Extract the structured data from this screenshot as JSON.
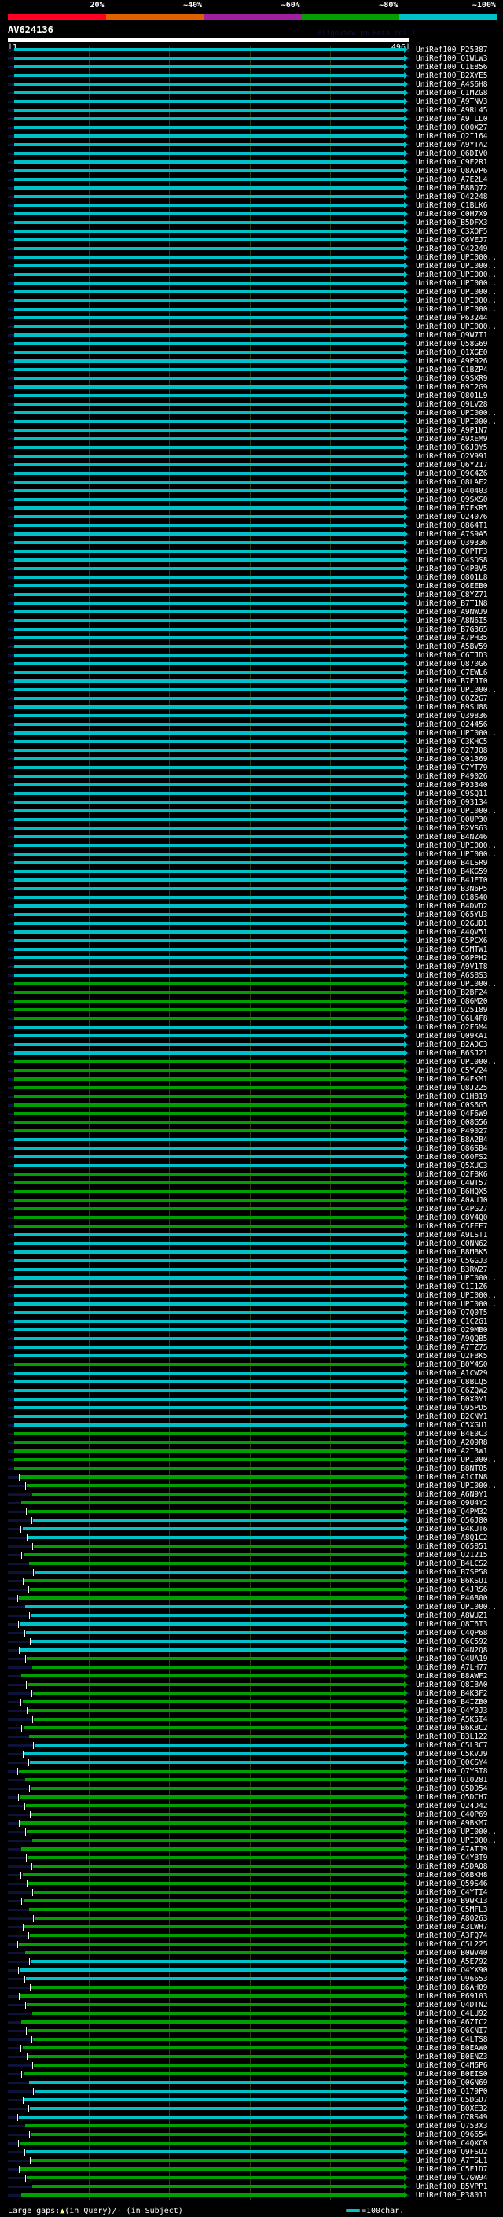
{
  "header": {
    "identity_scale": [
      {
        "label": "20%",
        "color": "#ff0022"
      },
      {
        "label": "~40%",
        "color": "#e06000"
      },
      {
        "label": "~60%",
        "color": "#a020a0"
      },
      {
        "label": "~80%",
        "color": "#00a000"
      },
      {
        "label": "~100%",
        "color": "#00c0c8"
      }
    ],
    "query_name": "AV624136",
    "version": "AlignView.pm Beta rel.7",
    "query_start": "|1",
    "query_end": "496|",
    "query_length": 496
  },
  "hits": [
    "UniRef100_P25387",
    "UniRef100_Q1WLW3",
    "UniRef100_C1E856",
    "UniRef100_B2XYE5",
    "UniRef100_A4S6H8",
    "UniRef100_C1MZG8",
    "UniRef100_A9TNV3",
    "UniRef100_A9RL45",
    "UniRef100_A9TLL0",
    "UniRef100_Q00X27",
    "UniRef100_Q2I164",
    "UniRef100_A9YTA2",
    "UniRef100_Q6DIV0",
    "UniRef100_C9E2R1",
    "UniRef100_Q8AVP6",
    "UniRef100_A7E2L4",
    "UniRef100_B8BQ72",
    "UniRef100_O42248",
    "UniRef100_C1BLK6",
    "UniRef100_C0H7X9",
    "UniRef100_B5DFX3",
    "UniRef100_C3XQF5",
    "UniRef100_Q6VEJ7",
    "UniRef100_O42249",
    "UniRef100_UPI000..",
    "UniRef100_UPI000..",
    "UniRef100_UPI000..",
    "UniRef100_UPI000..",
    "UniRef100_UPI000..",
    "UniRef100_UPI000..",
    "UniRef100_UPI000..",
    "UniRef100_P63244",
    "UniRef100_UPI000..",
    "UniRef100_Q9W7I1",
    "UniRef100_Q58G69",
    "UniRef100_Q1XGE0",
    "UniRef100_A9P926",
    "UniRef100_C1BZP4",
    "UniRef100_Q9SXR9",
    "UniRef100_B9I2G9",
    "UniRef100_Q801L9",
    "UniRef100_Q9LV28",
    "UniRef100_UPI000..",
    "UniRef100_UPI000..",
    "UniRef100_A9P1N7",
    "UniRef100_A9XEM9",
    "UniRef100_Q6J0Y5",
    "UniRef100_Q2V991",
    "UniRef100_Q6Y217",
    "UniRef100_Q9C4Z6",
    "UniRef100_Q8LAF2",
    "UniRef100_Q40403",
    "UniRef100_Q9SXS0",
    "UniRef100_B7FKR5",
    "UniRef100_O24076",
    "UniRef100_Q864T1",
    "UniRef100_A7S9A5",
    "UniRef100_Q39336",
    "UniRef100_C0PTF3",
    "UniRef100_Q4SDS8",
    "UniRef100_Q4PBV5",
    "UniRef100_Q801L8",
    "UniRef100_Q6EEB0",
    "UniRef100_C8YZ71",
    "UniRef100_B7T1N8",
    "UniRef100_A9NWJ9",
    "UniRef100_A8N6I5",
    "UniRef100_B7G365",
    "UniRef100_A7PH35",
    "UniRef100_A5BV59",
    "UniRef100_C6TJD3",
    "UniRef100_Q870G6",
    "UniRef100_C7EWL6",
    "UniRef100_B7FJT0",
    "UniRef100_UPI000..",
    "UniRef100_C0Z2G7",
    "UniRef100_B9SU88",
    "UniRef100_Q39836",
    "UniRef100_O24456",
    "UniRef100_UPI000..",
    "UniRef100_C3KHC5",
    "UniRef100_Q27JQ8",
    "UniRef100_Q01369",
    "UniRef100_C7YT79",
    "UniRef100_P49026",
    "UniRef100_P93340",
    "UniRef100_C9SQ11",
    "UniRef100_Q93134",
    "UniRef100_UPI000..",
    "UniRef100_Q0UP30",
    "UniRef100_B2VS63",
    "UniRef100_B4NZ46",
    "UniRef100_UPI000..",
    "UniRef100_UPI000..",
    "UniRef100_B4LSR9",
    "UniRef100_B4KG59",
    "UniRef100_B4JEI0",
    "UniRef100_B3N6P5",
    "UniRef100_O18640",
    "UniRef100_B4DVD2",
    "UniRef100_Q65YU3",
    "UniRef100_Q2GUD1",
    "UniRef100_A4QV51",
    "UniRef100_C5PCX6",
    "UniRef100_C5MTW1",
    "UniRef100_Q6PPH2",
    "UniRef100_A9V1T8",
    "UniRef100_A6SBS3",
    "UniRef100_UPI000..",
    "UniRef100_B2BF24",
    "UniRef100_Q86M20",
    "UniRef100_Q25189",
    "UniRef100_Q6L4F8",
    "UniRef100_Q2F5M4",
    "UniRef100_Q09KA1",
    "UniRef100_B2ADC3",
    "UniRef100_B6SJ21",
    "UniRef100_UPI000..",
    "UniRef100_C5YV24",
    "UniRef100_B4FKM1",
    "UniRef100_Q8J225",
    "UniRef100_C1H819",
    "UniRef100_C0S6G5",
    "UniRef100_Q4F6W9",
    "UniRef100_Q08G56",
    "UniRef100_P49027",
    "UniRef100_B8A2B4",
    "UniRef100_Q86SB4",
    "UniRef100_Q60FS2",
    "UniRef100_Q5XUC3",
    "UniRef100_Q2FBK6",
    "UniRef100_C4WT57",
    "UniRef100_B6HQX5",
    "UniRef100_A0AUJ0",
    "UniRef100_C4PG27",
    "UniRef100_C8V4Q0",
    "UniRef100_C5FEE7",
    "UniRef100_A9LST1",
    "UniRef100_C0NN62",
    "UniRef100_B8MBK5",
    "UniRef100_C5GGJ3",
    "UniRef100_B3RW27",
    "UniRef100_UPI000..",
    "UniRef100_C1I1Z6",
    "UniRef100_UPI000..",
    "UniRef100_UPI000..",
    "UniRef100_Q7Q0T5",
    "UniRef100_C1C2G1",
    "UniRef100_Q29MB0",
    "UniRef100_A9QQB5",
    "UniRef100_A7TZ75",
    "UniRef100_Q2FBK5",
    "UniRef100_B0Y4S0",
    "UniRef100_A1CW29",
    "UniRef100_C8BLQ5",
    "UniRef100_C6ZQW2",
    "UniRef100_B0X0Y1",
    "UniRef100_Q95PD5",
    "UniRef100_B2CNY1",
    "UniRef100_C5XGU1",
    "UniRef100_B4E0C3",
    "UniRef100_A2Q9R8",
    "UniRef100_A2I3W1",
    "UniRef100_UPI000..",
    "UniRef100_B8NT05",
    "UniRef100_A1CIN8",
    "UniRef100_UPI000..",
    "UniRef100_A6N9Y1",
    "UniRef100_Q9U4Y2",
    "UniRef100_Q4PM32",
    "UniRef100_Q56J80",
    "UniRef100_B4KUT6",
    "UniRef100_A8Q1C2",
    "UniRef100_O65851",
    "UniRef100_Q21215",
    "UniRef100_B4LCS2",
    "UniRef100_B7SP58",
    "UniRef100_B6KSU1",
    "UniRef100_C4JRS6",
    "UniRef100_P46800",
    "UniRef100_UPI000..",
    "UniRef100_A8WUZ1",
    "UniRef100_Q8T6T3",
    "UniRef100_C4QP68",
    "UniRef100_Q6C592",
    "UniRef100_Q4N2Q8",
    "UniRef100_Q4UA19",
    "UniRef100_A7LH77",
    "UniRef100_B8AWF2",
    "UniRef100_Q8IBA0",
    "UniRef100_B4K3F2",
    "UniRef100_B4IZB0",
    "UniRef100_Q4Y0J3",
    "UniRef100_A5K5I4",
    "UniRef100_B6K8C2",
    "UniRef100_B3L122",
    "UniRef100_C5L3C7",
    "UniRef100_C5KVJ9",
    "UniRef100_Q0CSY4",
    "UniRef100_Q7YST8",
    "UniRef100_Q10281",
    "UniRef100_Q5DD54",
    "UniRef100_Q5DCH7",
    "UniRef100_Q24D42",
    "UniRef100_C4QP69",
    "UniRef100_A9BKM7",
    "UniRef100_UPI000..",
    "UniRef100_UPI000..",
    "UniRef100_A7ATJ9",
    "UniRef100_C4YBT9",
    "UniRef100_A5DAQ8",
    "UniRef100_Q6BKH8",
    "UniRef100_Q59S46",
    "UniRef100_C4YTI4",
    "UniRef100_B9WK13",
    "UniRef100_C5MFL3",
    "UniRef100_A8Q263",
    "UniRef100_A3LWH7",
    "UniRef100_A3FQ74",
    "UniRef100_C5L225",
    "UniRef100_B0WV40",
    "UniRef100_A5E792",
    "UniRef100_Q4YX90",
    "UniRef100_O96653",
    "UniRef100_B6AH09",
    "UniRef100_P69103",
    "UniRef100_Q4DTN2",
    "UniRef100_C4LU92",
    "UniRef100_A6ZIC2",
    "UniRef100_Q6CNI7",
    "UniRef100_C4LTS8",
    "UniRef100_B0EAW0",
    "UniRef100_B0ENZ3",
    "UniRef100_C4M6P6",
    "UniRef100_B0EIS0",
    "UniRef100_Q0GN69",
    "UniRef100_Q179P0",
    "UniRef100_C5DGD7",
    "UniRef100_B0XE32",
    "UniRef100_Q7RS49",
    "UniRef100_Q753X3",
    "UniRef100_O96654",
    "UniRef100_C4QXC0",
    "UniRef100_Q9FSU2",
    "UniRef100_A7TSL1",
    "UniRef100_C5E1D7",
    "UniRef100_C7GW94",
    "UniRef100_B5VPP1",
    "UniRef100_P38011"
  ],
  "identity_ranges_green": [
    [
      109,
      113
    ],
    [
      118,
      126
    ],
    [
      131,
      137
    ],
    [
      153,
      153
    ],
    [
      161,
      170
    ],
    [
      174,
      176
    ],
    [
      178,
      180
    ],
    [
      187,
      196
    ],
    [
      200,
      221
    ],
    [
      225,
      235
    ],
    [
      241,
      243
    ],
    [
      245,
      249
    ]
  ],
  "colors": {
    "high": "#00c0c8",
    "mid": "#00a000",
    "grid": "#3a3410",
    "query_underlay": "#0c1238"
  },
  "legend": {
    "large_gaps_label": "Large gaps:",
    "query_gap_symbol": "▲",
    "query_gap_text": "(in Query)/",
    "subject_gap_symbol": "-",
    "subject_gap_text": " (in Subject)",
    "scale_text": "=100char."
  }
}
